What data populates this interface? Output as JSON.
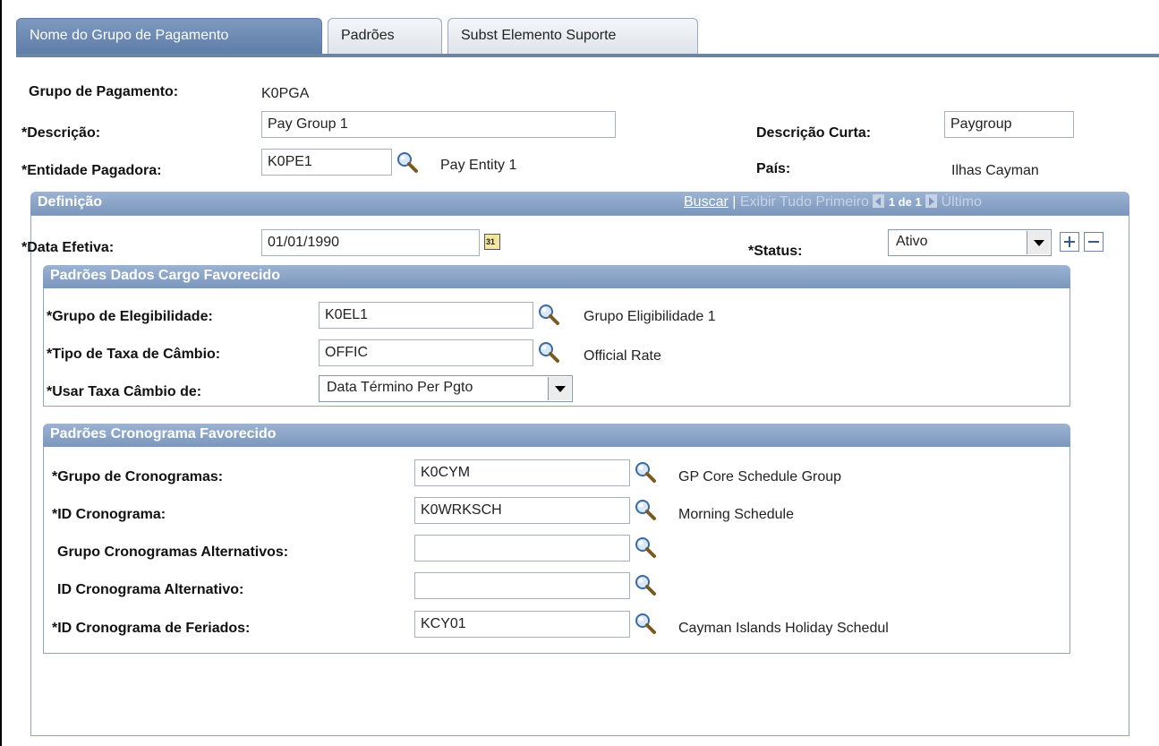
{
  "tabs": [
    {
      "label": "Nome do Grupo de Pagamento",
      "active": true
    },
    {
      "label": "Padrões",
      "active": false
    },
    {
      "label": "Subst Elemento Suporte",
      "active": false
    }
  ],
  "header": {
    "pay_group_label": "Grupo de Pagamento:",
    "pay_group_value": "K0PGA",
    "description_label": "*Descrição:",
    "description_value": "Pay Group 1",
    "short_desc_label": "Descrição Curta:",
    "short_desc_value": "Paygroup",
    "pay_entity_label": "*Entidade Pagadora:",
    "pay_entity_value": "K0PE1",
    "pay_entity_desc": "Pay Entity 1",
    "country_label": "País:",
    "country_value": "Ilhas Cayman"
  },
  "definition": {
    "title": "Definição",
    "nav_find": "Buscar",
    "nav_sep": "|",
    "nav_view_all": "Exibir Tudo",
    "nav_first": "Primeiro",
    "nav_count": "1 de 1",
    "nav_last": "Último",
    "eff_date_label": "*Data Efetiva:",
    "eff_date_value": "01/01/1990",
    "calendar_text": "31",
    "status_label": "*Status:",
    "status_value": "Ativo"
  },
  "payee_job": {
    "title": "Padrões Dados Cargo Favorecido",
    "elig_label": "*Grupo de Elegibilidade:",
    "elig_value": "K0EL1",
    "elig_desc": "Grupo Eligibilidade 1",
    "rate_type_label": "*Tipo de Taxa de Câmbio:",
    "rate_type_value": "OFFIC",
    "rate_type_desc": "Official Rate",
    "use_rate_label": "*Usar Taxa Câmbio de:",
    "use_rate_value": "Data Término Per Pgto"
  },
  "payee_schedule": {
    "title": "Padrões Cronograma Favorecido",
    "sched_group_label": "*Grupo de Cronogramas:",
    "sched_group_value": "K0CYM",
    "sched_group_desc": "GP Core Schedule Group",
    "sched_id_label": "*ID Cronograma:",
    "sched_id_value": "K0WRKSCH",
    "sched_id_desc": "Morning Schedule",
    "alt_group_label": "Grupo Cronogramas Alternativos:",
    "alt_group_value": "",
    "alt_id_label": "ID Cronograma Alternativo:",
    "alt_id_value": "",
    "holiday_label": "*ID Cronograma de Feriados:",
    "holiday_value": "KCY01",
    "holiday_desc": "Cayman Islands Holiday Schedul"
  },
  "colors": {
    "tab_active": "#6b86a4",
    "header_bar": "#7b97bd",
    "border": "#8ea5c2"
  },
  "icons": {
    "lookup": "magnifier-icon",
    "calendar": "calendar-icon",
    "add": "plus-icon",
    "delete": "minus-icon"
  }
}
